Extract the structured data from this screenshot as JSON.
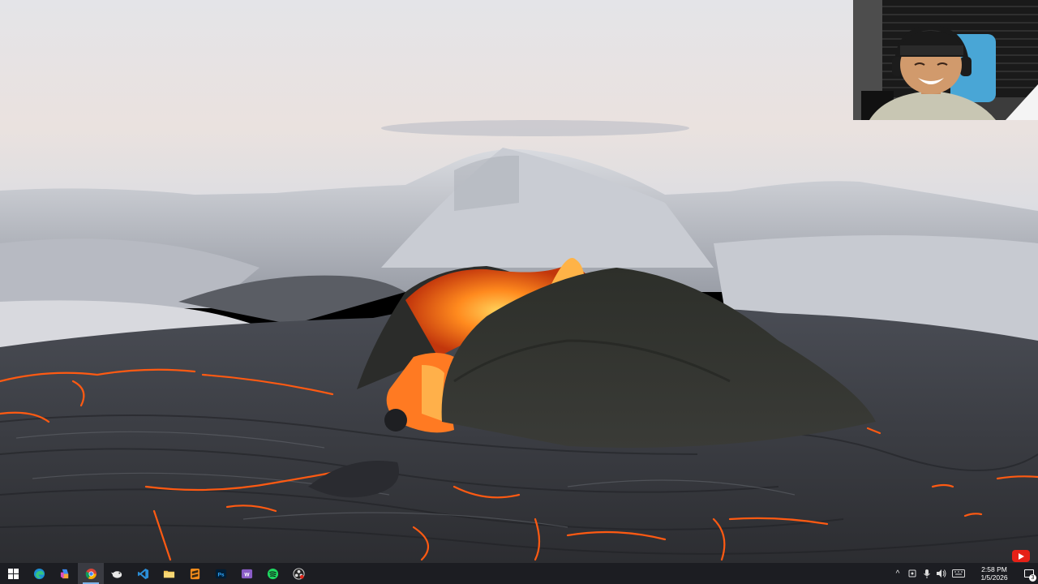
{
  "video": {
    "scene": "volcano-eruption"
  },
  "webcam": {
    "present": true
  },
  "taskbar": {
    "apps": [
      {
        "name": "start",
        "icon": "windows-logo-icon"
      },
      {
        "name": "edge",
        "icon": "edge-icon"
      },
      {
        "name": "copilot",
        "icon": "copilot-icon"
      },
      {
        "name": "chrome",
        "icon": "chrome-icon",
        "active": true
      },
      {
        "name": "app",
        "icon": "bird-app-icon"
      },
      {
        "name": "vscode",
        "icon": "vscode-icon"
      },
      {
        "name": "file-explorer",
        "icon": "folder-icon"
      },
      {
        "name": "sublime",
        "icon": "sublime-icon"
      },
      {
        "name": "photoshop",
        "icon": "photoshop-icon",
        "label": "Ps"
      },
      {
        "name": "app-w",
        "icon": "w-app-icon",
        "label": "W"
      },
      {
        "name": "spotify",
        "icon": "spotify-icon"
      },
      {
        "name": "obs",
        "icon": "obs-icon"
      }
    ],
    "tray": {
      "chevron": "^",
      "clock_time": "2:58 PM",
      "clock_date": "1/5/2026",
      "notification_count": "3"
    }
  },
  "colors": {
    "taskbar_bg": "#1c1d22",
    "accent": "#7eb4ea",
    "lava": "#ff6a1a"
  }
}
